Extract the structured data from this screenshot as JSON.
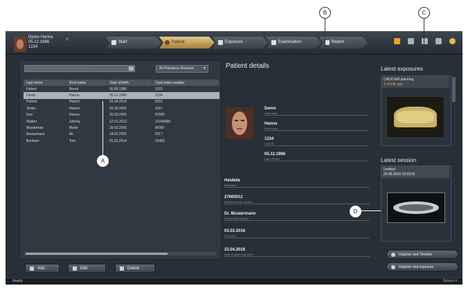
{
  "header": {
    "patient_name": "Demo Hanna",
    "patient_dob": "05.12.1986",
    "patient_id": "1234",
    "workflow": [
      "Start",
      "Patient",
      "Exposure",
      "Examination",
      "Report"
    ],
    "active_step": "Patient",
    "accent_color": "#e8c27a",
    "tool_icons": [
      "folder-icon",
      "tools-icon",
      "gear-icon",
      "monitor-icon",
      "user-icon"
    ]
  },
  "patient_list": {
    "search_placeholder": "Search patients (last name, first name...)",
    "filter_value": "All Planmeca Romexis",
    "columns": [
      "Last name",
      "First name",
      "Date of birth",
      "Card index number"
    ],
    "rows": [
      [
        "Hubert",
        "Bernd",
        "05.08.1980",
        "1515"
      ],
      [
        "Demo",
        "Hanna",
        "05.12.1986",
        "1234"
      ],
      [
        "Patient",
        "Hubert",
        "01.04.2014",
        "2016"
      ],
      [
        "Tester",
        "Hubert",
        "03.05.2001",
        "1167"
      ],
      [
        "Doe",
        "Hanna",
        "20.03.2001",
        "37890"
      ],
      [
        "Walker",
        "Johnny",
        "12.01.2012",
        "12345688"
      ],
      [
        "Mustermax",
        "Marie",
        "29.03.2001",
        "56987"
      ],
      [
        "Anonymous",
        "Mr.",
        "18.02.2001",
        "2017"
      ],
      [
        "Bonham",
        "Toni",
        "01.01.2014",
        "23455"
      ]
    ],
    "selected_row": 1,
    "buttons": {
      "add": "Add",
      "edit": "Edit",
      "delete": "Delete"
    }
  },
  "details": {
    "title": "Patient details",
    "fields": [
      {
        "value": "Demo",
        "label": "Last name"
      },
      {
        "value": "Hanna",
        "label": "First name"
      },
      {
        "value": "1234",
        "label": "Card ID"
      },
      {
        "value": "05.12.1986",
        "label": "Date of birth"
      }
    ],
    "extra": [
      {
        "value": "Heidelie",
        "label": "Birthplace"
      },
      {
        "value": "27600012",
        "label": "Social security number"
      },
      {
        "value": "Dr. Mustermann",
        "label": "Responsible dentist"
      },
      {
        "value": "03.03.2016",
        "label": "First visit"
      },
      {
        "value": "23.04.2016",
        "label": "Date of latest exposure"
      }
    ]
  },
  "latest_exposures": {
    "heading": "Latest exposures",
    "title": "CAD/CAM planning",
    "subtitle": "1 month ago"
  },
  "latest_session": {
    "heading": "Latest session",
    "title": "Untitled",
    "subtitle": "20.06.2016 15:03:51"
  },
  "actions": {
    "register_timeline": "Register and Timeline",
    "register_exposure": "Register and exposure"
  },
  "callouts": {
    "a": "A",
    "b": "B",
    "c": "C",
    "d": "D"
  },
  "status": {
    "left": "Ready",
    "right": "Sidexis 4"
  }
}
